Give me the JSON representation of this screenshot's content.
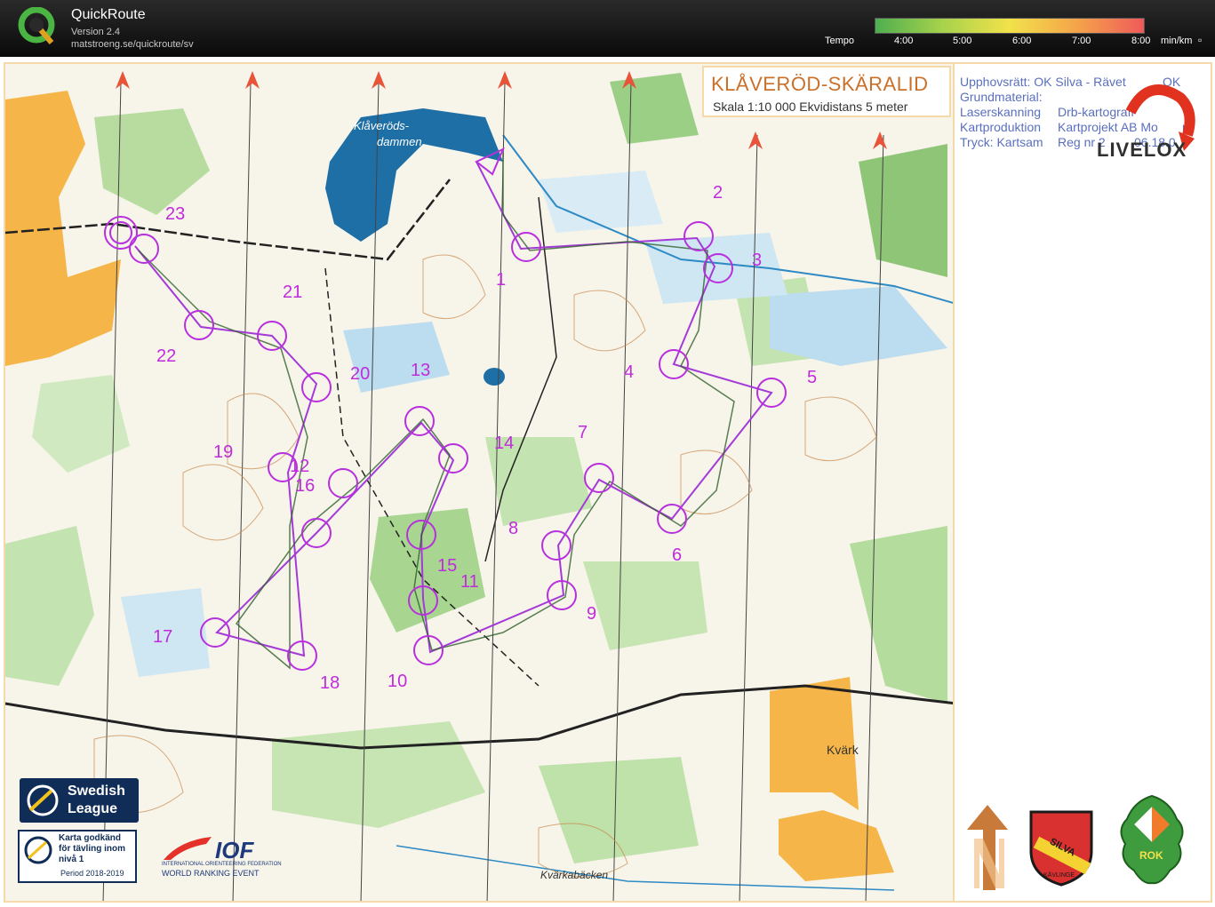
{
  "app": {
    "name": "QuickRoute",
    "version": "Version 2.4",
    "url": "matstroeng.se/quickroute/sv"
  },
  "tempo": {
    "label": "Tempo",
    "ticks": [
      "4:00",
      "5:00",
      "6:00",
      "7:00",
      "8:00"
    ],
    "unit": "min/km",
    "colors": [
      "#4fae4f",
      "#a7d24c",
      "#f2e24a",
      "#f4a44a",
      "#ee5a5a"
    ]
  },
  "window": {
    "restore_icon": "restore-icon"
  },
  "map": {
    "title": "KLÅVERÖD-SKÄRALID",
    "scale": "Skala 1:10 000 Ekvidistans 5 meter",
    "credits": [
      "Upphovsrätt: OK Silva - Rävet",
      "OK",
      "Grundmaterial:",
      "Laserskanning",
      "Drb-kartografi",
      "Kartproduktion",
      "Kartprojekt AB Mo",
      "m",
      "Tryck: Kartsam",
      "Reg nr 2",
      "06.18.0"
    ],
    "place_names": [
      "Klåveröds-",
      "dammen",
      "Kvärk",
      "Kvärkabäcken"
    ],
    "controls": [
      "1",
      "2",
      "3",
      "4",
      "5",
      "6",
      "7",
      "8",
      "9",
      "10",
      "11",
      "12",
      "13",
      "14",
      "15",
      "16",
      "17",
      "18",
      "19",
      "20",
      "21",
      "22",
      "23"
    ],
    "route_color": "#a43ad8",
    "control_color": "#c02bdc"
  },
  "logos": {
    "livelox": "LIVELOX",
    "swedish_league_1": "Swedish",
    "swedish_league_2": "League",
    "approved_1": "Karta godkänd",
    "approved_2": "för tävling inom",
    "approved_3": "nivå 1",
    "approved_4": "Period 2018-2019",
    "iof_main": "IOF",
    "iof_sub": "INTERNATIONAL ORIENTEERING FEDERATION",
    "iof_event": "WORLD RANKING EVENT",
    "silva_1": "SILVA",
    "silva_2": "KÄVLINGE",
    "rok": "ROK"
  }
}
